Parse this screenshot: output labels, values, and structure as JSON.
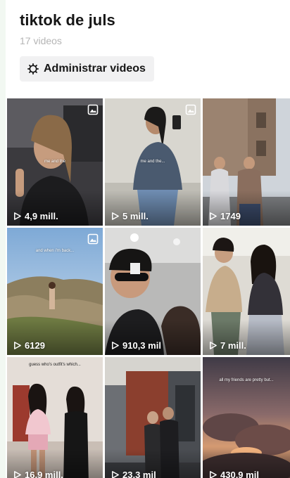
{
  "playlist": {
    "title": "tiktok de juls",
    "video_count": "17 videos",
    "manage_label": "Administrar videos"
  },
  "icons": {
    "manage": "gear-icon",
    "views": "play-outline-icon",
    "multi": "multi-photo-icon"
  },
  "videos": [
    {
      "views": "4,9 mill.",
      "caption": "me and the",
      "multi": true
    },
    {
      "views": "5 mill.",
      "caption": "me and the...",
      "multi": true
    },
    {
      "views": "1749",
      "caption": "",
      "multi": false
    },
    {
      "views": "6129",
      "caption": "and when i'm back...",
      "multi": true
    },
    {
      "views": "910,3 mil",
      "caption": "",
      "multi": false
    },
    {
      "views": "7 mill.",
      "caption": "",
      "multi": false
    },
    {
      "views": "16,9 mill.",
      "caption": "guess who's outfit's which...",
      "multi": false
    },
    {
      "views": "23,3 mil",
      "caption": "",
      "multi": false
    },
    {
      "views": "430,9 mil",
      "caption": "all my friends are pretty but...",
      "multi": false
    }
  ]
}
